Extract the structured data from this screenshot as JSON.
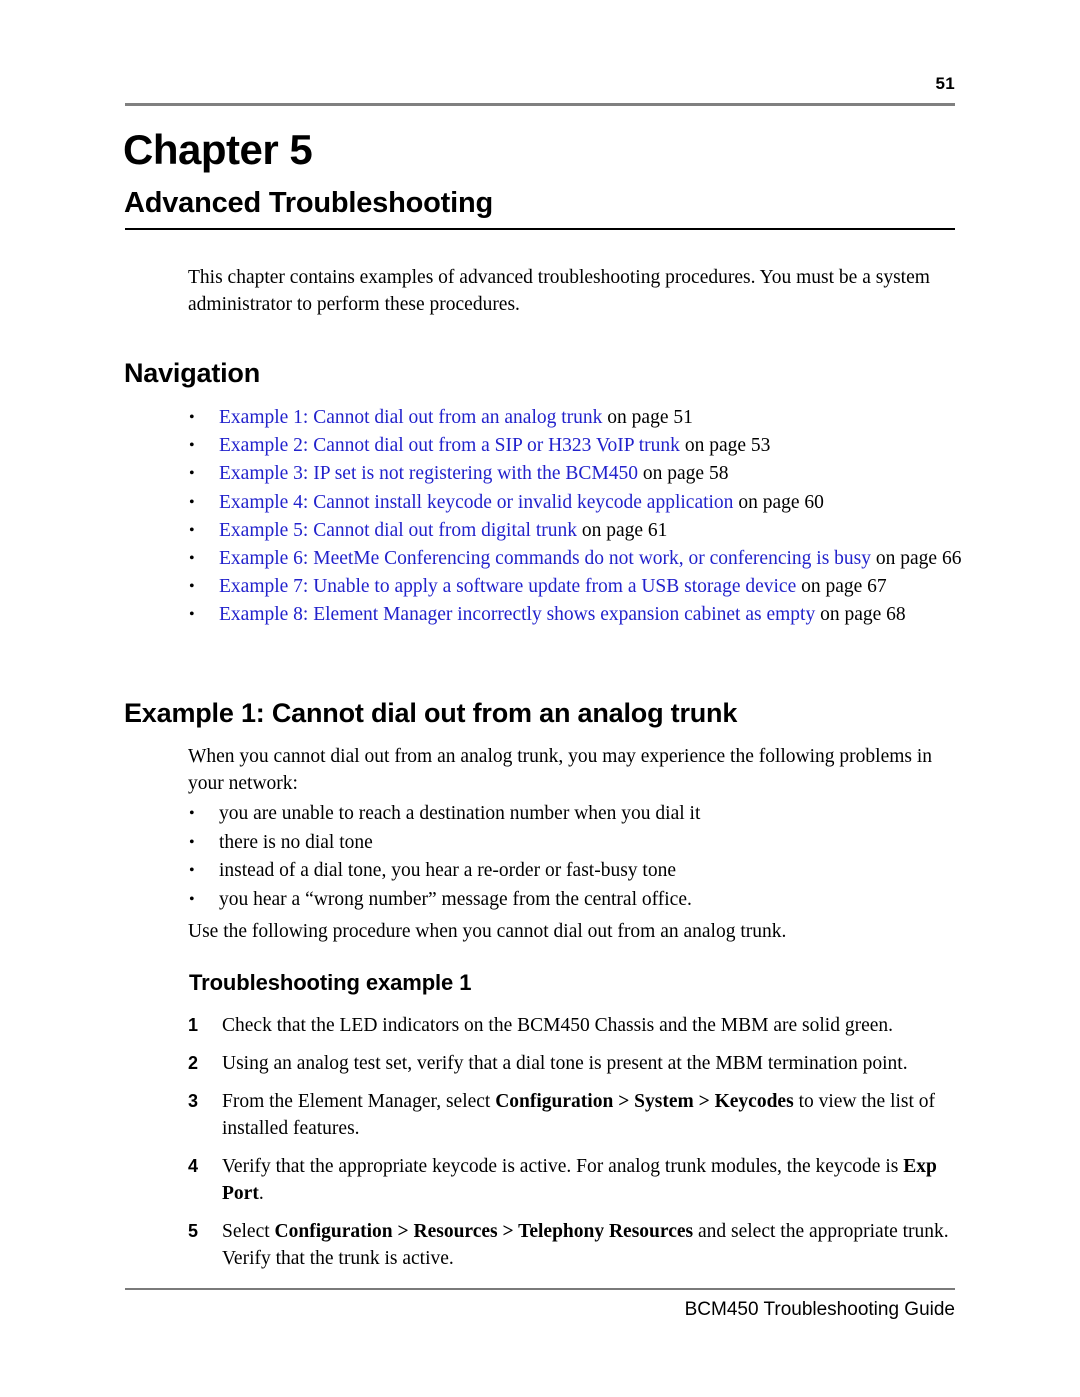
{
  "header": {
    "page_number": "51"
  },
  "chapter": {
    "label": "Chapter 5",
    "title": "Advanced Troubleshooting",
    "intro": "This chapter contains examples of advanced troubleshooting procedures. You must be a system administrator to perform these procedures."
  },
  "navigation": {
    "heading": "Navigation",
    "bullet": "•",
    "items": [
      {
        "link": "Example 1: Cannot dial out from an analog trunk",
        "page_ref": " on page 51"
      },
      {
        "link": "Example 2: Cannot dial out from a SIP or H323 VoIP trunk",
        "page_ref": " on page 53"
      },
      {
        "link": "Example 3: IP set is not registering with the BCM450",
        "page_ref": " on page 58"
      },
      {
        "link": "Example 4: Cannot install keycode or invalid keycode application",
        "page_ref": " on page 60"
      },
      {
        "link": "Example 5: Cannot dial out from digital trunk",
        "page_ref": " on page 61"
      },
      {
        "link": "Example 6: MeetMe Conferencing commands do not work, or conferencing is busy",
        "page_ref": " on page 66"
      },
      {
        "link": "Example 7: Unable to apply a software update from a USB storage device",
        "page_ref": " on page 67"
      },
      {
        "link": "Example 8: Element Manager incorrectly shows expansion cabinet as empty",
        "page_ref": " on page 68"
      }
    ]
  },
  "example1": {
    "heading": "Example 1: Cannot dial out from an analog trunk",
    "intro": "When you cannot dial out from an analog trunk, you may experience the following problems in your network:",
    "symptoms": [
      "you are unable to reach a destination number when you dial it",
      "there is no dial tone",
      "instead of a dial tone, you hear a re-order or fast-busy tone",
      "you hear a “wrong number” message from the central office."
    ],
    "use_line": "Use the following procedure when you cannot dial out from an analog trunk.",
    "subheading": "Troubleshooting example 1",
    "steps": [
      {
        "number": "1",
        "parts": [
          {
            "text": "Check that the LED indicators on the BCM450 Chassis and the MBM are solid green.",
            "bold": false
          }
        ]
      },
      {
        "number": "2",
        "parts": [
          {
            "text": "Using an analog test set, verify that a dial tone is present at the MBM termination point.",
            "bold": false
          }
        ]
      },
      {
        "number": "3",
        "parts": [
          {
            "text": "From the Element Manager, select ",
            "bold": false
          },
          {
            "text": "Configuration > System > Keycodes",
            "bold": true
          },
          {
            "text": " to view the list of installed features.",
            "bold": false
          }
        ]
      },
      {
        "number": "4",
        "parts": [
          {
            "text": "Verify that the appropriate keycode is active. For analog trunk modules, the keycode is ",
            "bold": false
          },
          {
            "text": "Exp Port",
            "bold": true
          },
          {
            "text": ".",
            "bold": false
          }
        ]
      },
      {
        "number": "5",
        "parts": [
          {
            "text": "Select ",
            "bold": false
          },
          {
            "text": "Configuration > Resources > Telephony Resources",
            "bold": true
          },
          {
            "text": " and select the appropriate trunk. Verify that the trunk is active.",
            "bold": false
          }
        ]
      }
    ]
  },
  "footer": {
    "text": "BCM450 Troubleshooting Guide"
  },
  "colors": {
    "link": "#2222cc",
    "header_rule": "#808080",
    "title_rule": "#000000",
    "text": "#000000"
  }
}
